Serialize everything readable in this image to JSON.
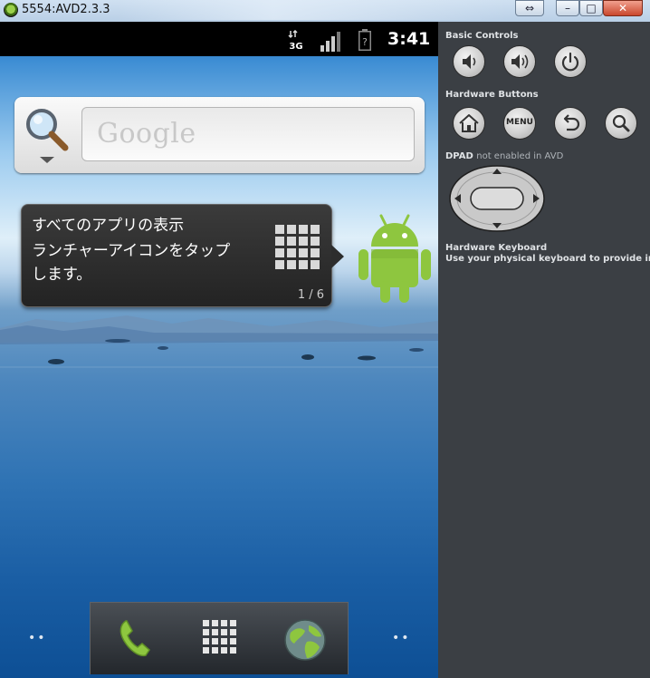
{
  "window": {
    "title": "5554:AVD2.3.3",
    "controls": [
      "resize",
      "minimize",
      "maximize",
      "close"
    ]
  },
  "status_bar": {
    "time": "3:41",
    "network": "3G"
  },
  "search_widget": {
    "logo_text": "Google"
  },
  "tutorial": {
    "title": "すべてのアプリの表示",
    "line2": "ランチャーアイコンをタップ",
    "line3": "します。",
    "page_indicator": "1 / 6"
  },
  "dock": {
    "left_dots": "••",
    "right_dots": "••",
    "icons": [
      "phone-icon",
      "app-drawer-icon",
      "browser-globe-icon"
    ]
  },
  "controls": {
    "basic_controls_label": "Basic Controls",
    "hardware_buttons_label": "Hardware Buttons",
    "menu_label": "MENU",
    "dpad_label": "DPAD",
    "dpad_note": "not enabled in AVD",
    "keyboard_label": "Hardware Keyboard",
    "keyboard_note": "Use your physical keyboard to provide input"
  },
  "icons": {
    "basic": [
      "volume-down-icon",
      "volume-up-icon",
      "power-icon"
    ],
    "hardware": [
      "home-icon",
      "menu-button",
      "back-icon",
      "search-icon"
    ]
  },
  "colors": {
    "android_green": "#8ec63f",
    "panel_background": "#3b3f44",
    "status_bar": "#000000"
  }
}
